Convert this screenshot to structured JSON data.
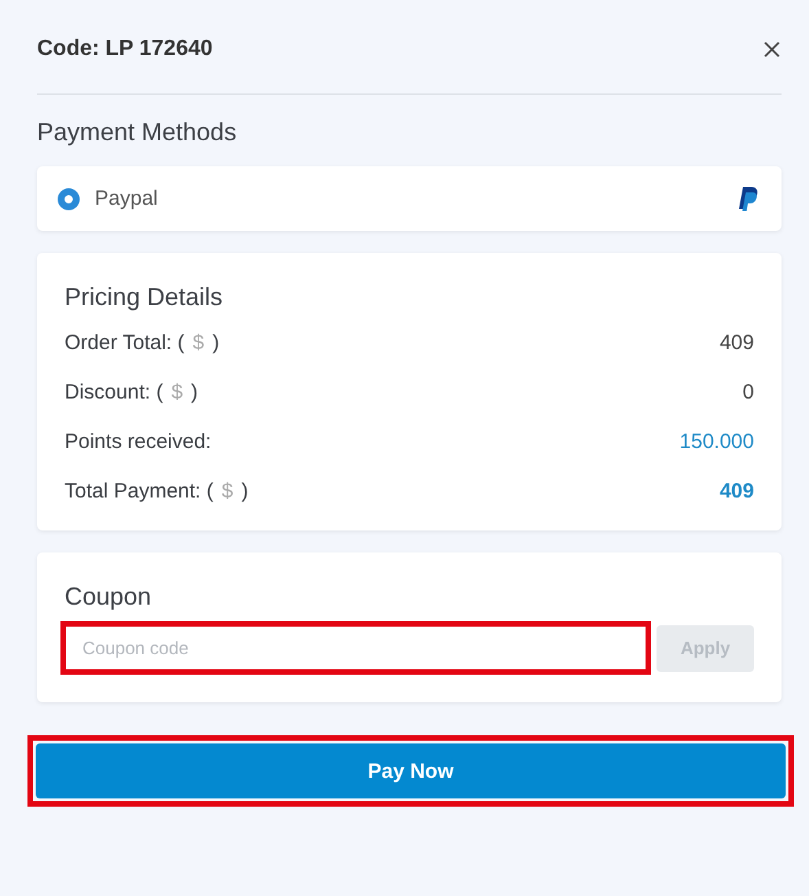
{
  "header": {
    "title": "Code: LP 172640"
  },
  "payment_methods": {
    "title": "Payment Methods",
    "options": [
      {
        "label": "Paypal",
        "selected": true
      }
    ]
  },
  "pricing": {
    "title": "Pricing Details",
    "rows": [
      {
        "label": "Order Total: (",
        "currency": "$",
        "suffix": ")",
        "value": "409",
        "kind": "plain"
      },
      {
        "label": "Discount: (",
        "currency": "$",
        "suffix": ")",
        "value": "0",
        "kind": "plain"
      },
      {
        "label": "Points received:",
        "value": "150.000",
        "kind": "points"
      },
      {
        "label": "Total Payment: (",
        "currency": "$",
        "suffix": ")",
        "value": "409",
        "kind": "total"
      }
    ]
  },
  "coupon": {
    "title": "Coupon",
    "placeholder": "Coupon code",
    "highlighted": true,
    "apply": {
      "label": "Apply",
      "disabled": true
    }
  },
  "pay_button": {
    "label": "Pay Now",
    "highlighted": true
  }
}
